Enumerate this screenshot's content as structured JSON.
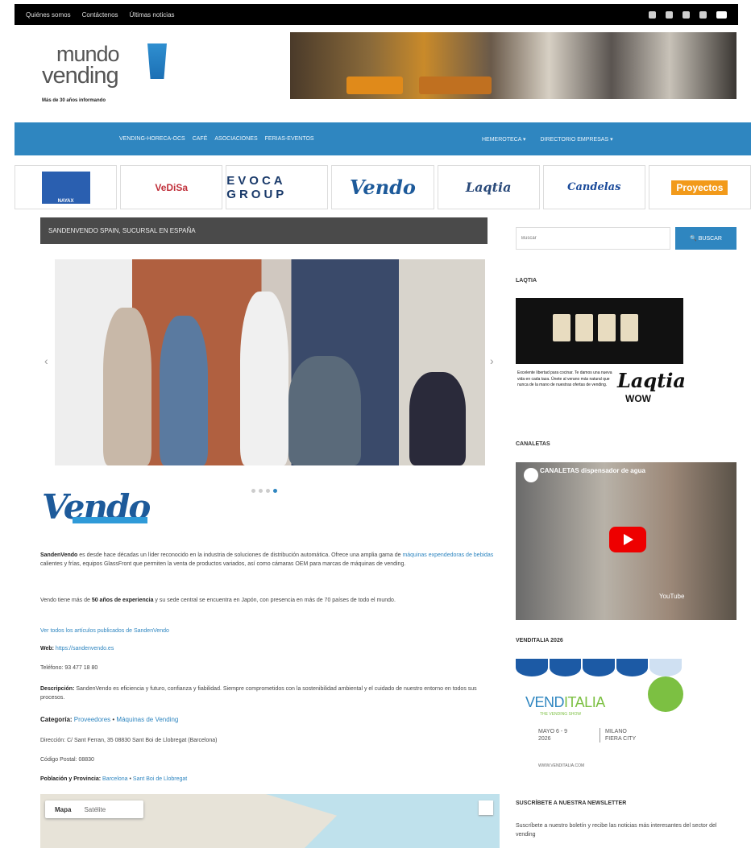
{
  "topbar": {
    "links": [
      "Quiénes somos",
      "Contáctenos",
      "Últimas noticias"
    ],
    "social_icons": [
      "x-icon",
      "instagram-icon",
      "facebook-icon",
      "linkedin-icon",
      "youtube-icon"
    ]
  },
  "logo": {
    "line1": "mundo",
    "line2": "vending",
    "tagline": "Más de 30 años informando"
  },
  "nav": {
    "left": [
      "VENDING-HORECA-OCS",
      "CAFÉ",
      "ASOCIACIONES",
      "FERIAS-EVENTOS"
    ],
    "right": [
      "HEMEROTECA ▾",
      "DIRECTORIO EMPRESAS ▾"
    ]
  },
  "partners": [
    "NAYAX",
    "VeDiSa",
    "EVOCA GROUP",
    "Vendo",
    "Laqtia",
    "Candelas",
    "Proyectos"
  ],
  "post": {
    "title": "SANDENVENDO SPAIN, SUCURSAL EN ESPAÑA"
  },
  "slider": {
    "prev": "‹",
    "next": "›",
    "dots": 4,
    "active": 3
  },
  "company": {
    "logo": "Vendo",
    "logo_sub": "SANDEN"
  },
  "content": {
    "p1_lead": "SandenVendo",
    "p1": " es desde hace décadas un líder reconocido en la industria de soluciones de distribución automática. Ofrece una amplia gama de ",
    "p1_link": "máquinas expendedoras de bebidas",
    "p1_rest": " calientes y frías, equipos GlassFront que permiten la venta de productos variados, así como cámaras OEM para marcas de máquinas de vending.",
    "p2_pre": "Vendo tiene más de ",
    "p2_bold": "50 años de experiencia",
    "p2": " y su sede central se encuentra en Japón, con presencia en más de 70 países de todo el mundo.",
    "link_all": "Ver todos los artículos publicados de SandenVendo",
    "web_label": "Web:",
    "web": " https://sandenvendo.es",
    "phone": "Teléfono: 93 477 18 80",
    "desc_label": "Descripción:",
    "desc": " SandenVendo es eficiencia y futuro, confianza y fiabilidad. Siempre comprometidos con la sostenibilidad ambiental y el cuidado de nuestro entorno en todos sus procesos.",
    "cat_label": "Categoría:",
    "cat": "Proveedores",
    "cat2": "Máquinas de Vending",
    "addr": "Dirección: C/ Sant Ferran, 35 08830 Sant Boi de Llobregat (Barcelona)",
    "cp": "Código Postal: 08830",
    "pob_label": "Población y Provincia:",
    "pob": "Barcelona",
    "pob2": "Sant Boi de Llobregat"
  },
  "map": {
    "tab1": "Mapa",
    "tab2": "Satélite"
  },
  "sidebar": {
    "search_placeholder": "Buscar",
    "search_btn": "🔍 BUSCAR",
    "w1": "LAQTIA",
    "ad_text": "Excelente libertad para cocinar. Te damos una nueva vida en cada taza. Únete al verano más natural que nunca de la mano de nuestras ofertas de vending.",
    "ad_brand": "Laqtia",
    "ad_wow": "WOW",
    "w2": "CANALETAS",
    "video_title": "CANALETAS dispensador de agua",
    "video_yt": "YouTube",
    "w3": "VENDITALIA 2026",
    "vend_name1": "VEND",
    "vend_name2": "ITALIA",
    "vend_sub": "THE VENDING SHOW",
    "vend_date": "MAYO 6 - 9\n2026",
    "vend_place": "MILANO\nFIERA CITY",
    "vend_footer": "WWW.VENDITALIA.COM",
    "w4": "SUSCRÍBETE A NUESTRA NEWSLETTER",
    "news": "Suscríbete a nuestro boletín y recibe las noticias más interesantes del sector del vending"
  }
}
